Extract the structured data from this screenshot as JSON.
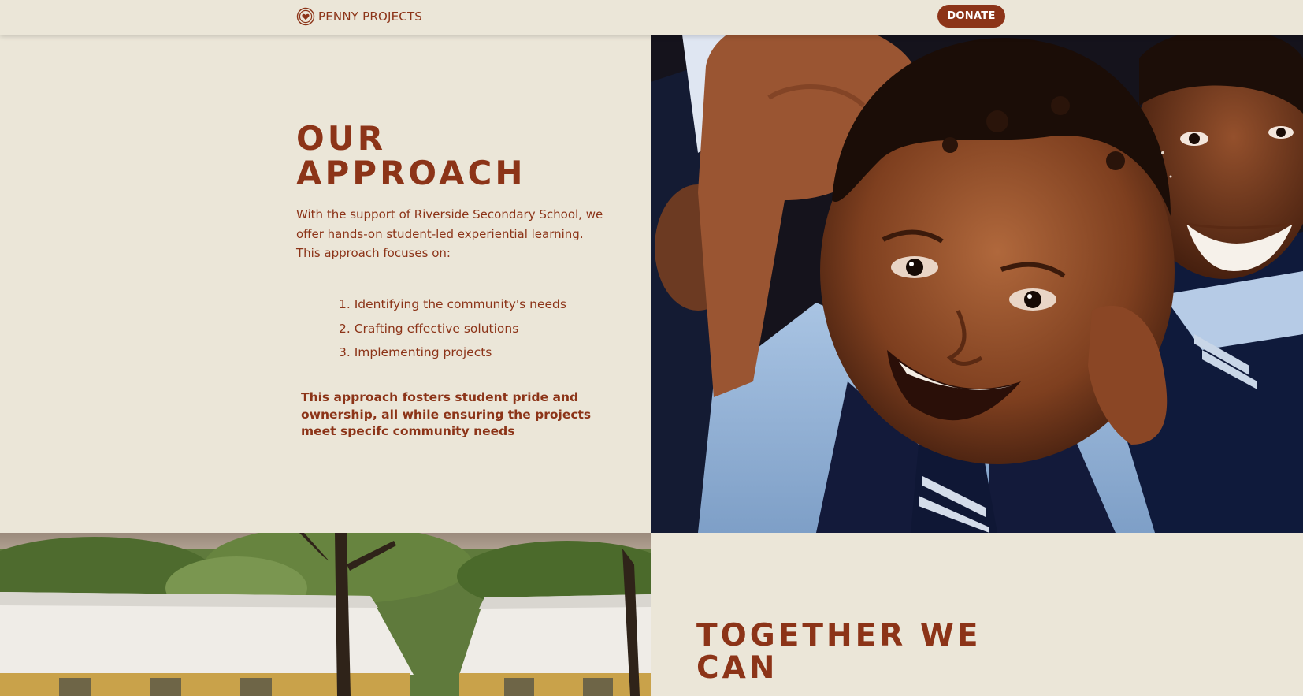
{
  "header": {
    "brand": "PENNY PROJECTS",
    "logo_icon": "heart-circle-icon",
    "donate_label": "DONATE"
  },
  "approach": {
    "title_line1": "OUR",
    "title_line2": "APPROACH",
    "intro": "With the support of Riverside Secondary School, we offer hands-on student-led experiential learning. This approach focuses on:",
    "steps": [
      "1. Identifying the community's needs",
      "2. Crafting effective solutions",
      "3. Implementing projects"
    ],
    "closing": "This approach fosters student pride and ownership, all while ensuring the projects meet specifc community needs"
  },
  "together": {
    "title_line1": "TOGETHER WE",
    "title_line2": "CAN"
  },
  "colors": {
    "background": "#ebe6d8",
    "brand": "#8c3418"
  }
}
